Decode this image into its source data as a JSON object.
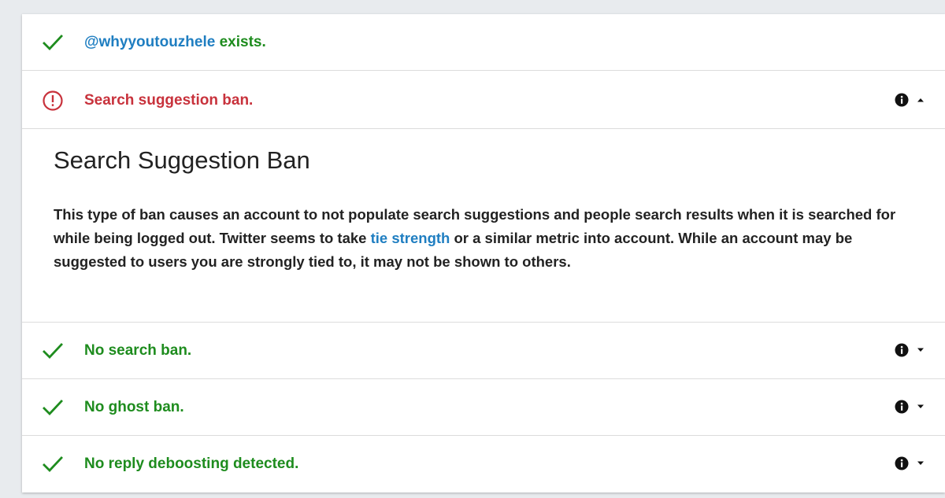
{
  "colors": {
    "success": "#1e8c1e",
    "error": "#c8323c",
    "link": "#1f7ec1"
  },
  "account_row": {
    "icon": "checkmark-icon",
    "handle": "@whyyoutouzhele",
    "text": " exists."
  },
  "search_suggestion_row": {
    "icon": "alert-circle-icon",
    "text": "Search suggestion ban.",
    "expanded": true
  },
  "detail": {
    "title": "Search Suggestion Ban",
    "body_before": "This type of ban causes an account to not populate search suggestions and people search results when it is searched for while being logged out. Twitter seems to take ",
    "link_text": "tie strength",
    "body_after": " or a similar metric into account. While an account may be suggested to users you are strongly tied to, it may not be shown to others."
  },
  "checks": [
    {
      "icon": "checkmark-icon",
      "text": "No search ban."
    },
    {
      "icon": "checkmark-icon",
      "text": "No ghost ban."
    },
    {
      "icon": "checkmark-icon",
      "text": "No reply deboosting detected."
    }
  ]
}
